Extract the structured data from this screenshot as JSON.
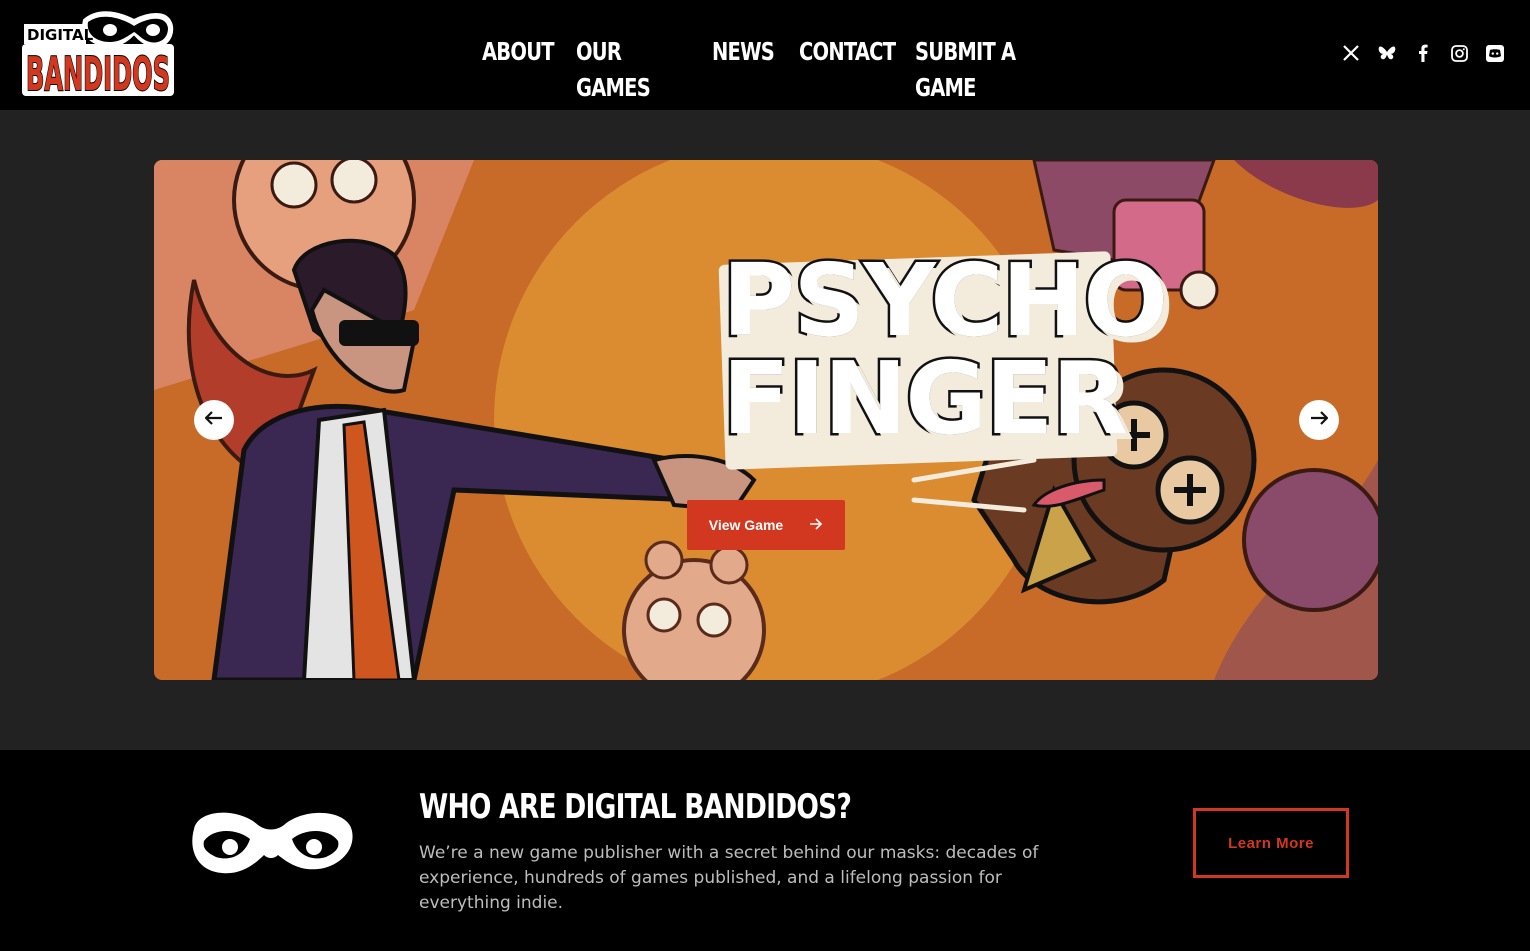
{
  "brand": {
    "logo_top": "DIGITAL",
    "logo_bottom": "BANDIDOS"
  },
  "nav": {
    "items": [
      {
        "label": "ABOUT"
      },
      {
        "label": "OUR GAMES"
      },
      {
        "label": "NEWS"
      },
      {
        "label": "CONTACT"
      },
      {
        "label": "SUBMIT A GAME"
      }
    ]
  },
  "social": {
    "icons": [
      "x-icon",
      "bluesky-icon",
      "facebook-icon",
      "instagram-icon",
      "discord-icon"
    ]
  },
  "hero": {
    "title_line1": "PSYCHO",
    "title_line2": "FINGER",
    "button_label": "View Game",
    "prev_icon": "arrow-left-icon",
    "next_icon": "arrow-right-icon"
  },
  "about": {
    "title": "WHO ARE DIGITAL BANDIDOS?",
    "text": "We’re a new game publisher with a secret behind our masks: decades of experience, hundreds of games published, and a lifelong passion for everything indie.",
    "button_label": "Learn More"
  },
  "colors": {
    "accent": "#d2381f",
    "header_bg": "#000000",
    "page_bg": "#222222"
  }
}
